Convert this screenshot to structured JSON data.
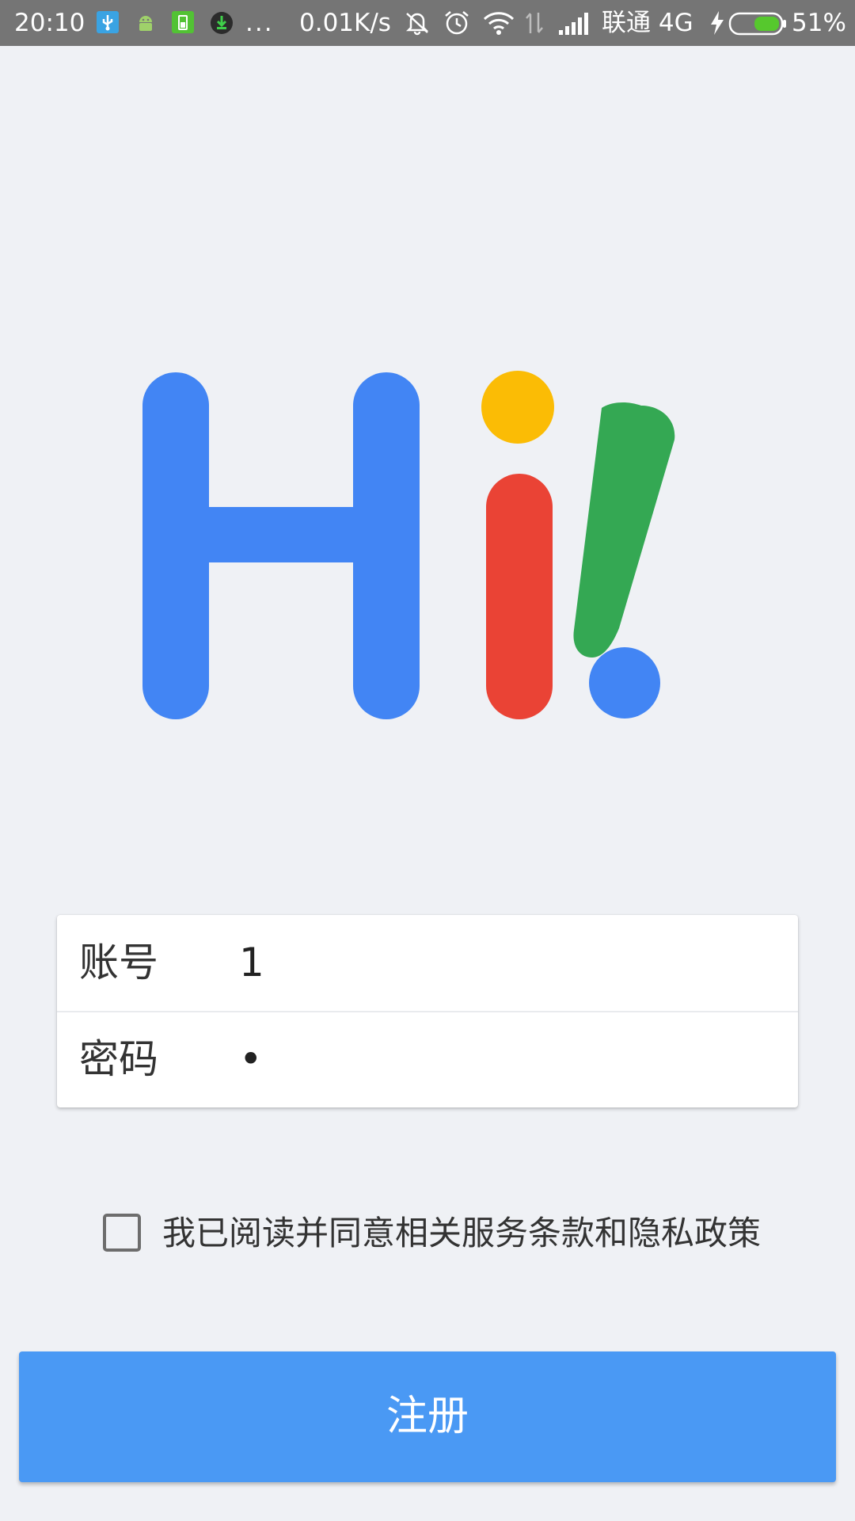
{
  "status_bar": {
    "time": "20:10",
    "more": "...",
    "speed": "0.01K/s",
    "carrier": "联通 4G",
    "battery": "51%",
    "icons": [
      "usb-icon",
      "android-icon",
      "battery-saver-icon",
      "download-icon",
      "mute-icon",
      "alarm-icon",
      "wifi-icon",
      "data-arrows-icon",
      "signal-icon",
      "charging-icon",
      "battery-icon"
    ]
  },
  "logo": {
    "text": "Hi!",
    "colors": {
      "blue": "#4285f4",
      "yellow": "#fbbc05",
      "red": "#ea4335",
      "green": "#34a853"
    }
  },
  "form": {
    "account_label": "账号",
    "account_value": "1",
    "password_label": "密码",
    "password_mask": "•"
  },
  "agreement": {
    "text": "我已阅读并同意相关服务条款和隐私政策",
    "checked": false
  },
  "register_button": {
    "label": "注册",
    "color": "#4a99f4"
  }
}
